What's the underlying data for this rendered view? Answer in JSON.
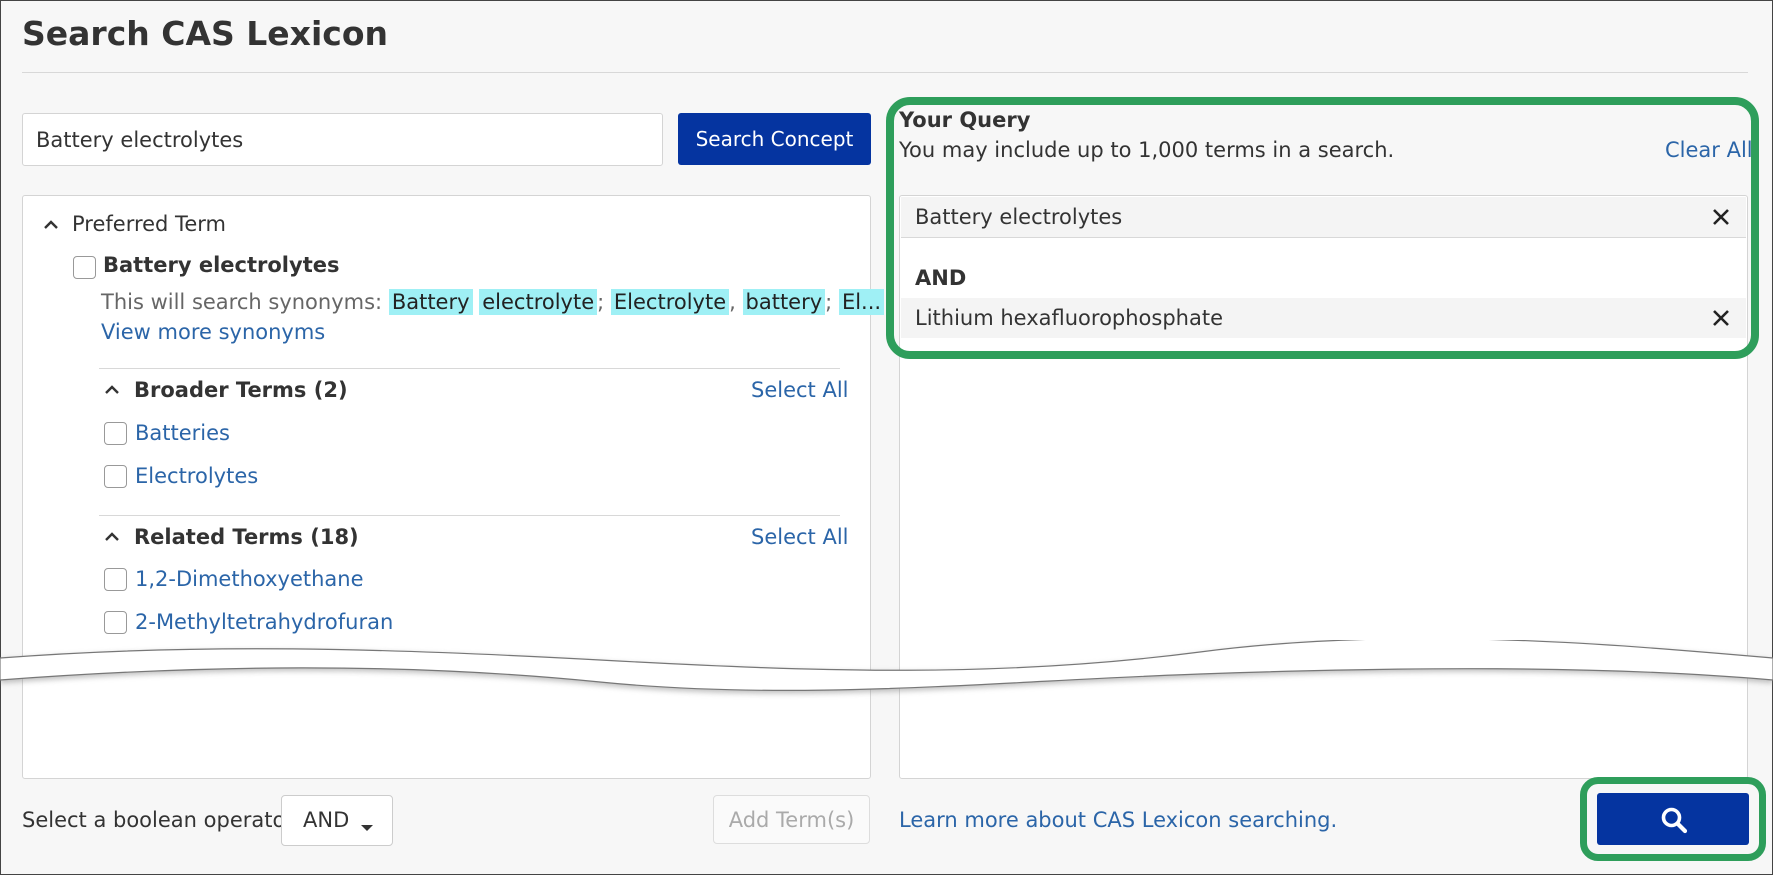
{
  "page": {
    "title": "Search CAS Lexicon"
  },
  "search": {
    "value": "Battery electrolytes",
    "button_label": "Search Concept"
  },
  "preferred": {
    "header": "Preferred Term",
    "term": "Battery electrolytes",
    "synonyms_prefix": "This will search synonyms:",
    "synonyms": [
      "Battery",
      "electrolyte",
      "Electrolyte",
      "battery",
      "El..."
    ],
    "separators": [
      ";",
      ",",
      ";"
    ],
    "view_more": "View more synonyms"
  },
  "broader": {
    "header": "Broader Terms (2)",
    "select_all": "Select All",
    "items": [
      "Batteries",
      "Electrolytes"
    ]
  },
  "related": {
    "header": "Related Terms (18)",
    "select_all": "Select All",
    "items": [
      "1,2-Dimethoxyethane",
      "2-Methyltetrahydrofuran"
    ]
  },
  "query": {
    "title": "Your Query",
    "hint": "You may include up to 1,000 terms in a search.",
    "clear_all": "Clear All",
    "items": [
      "Battery electrolytes",
      "Lithium hexafluorophosphate"
    ],
    "operator": "AND"
  },
  "bottom": {
    "operator_label": "Select a boolean operator",
    "operator_value": "AND",
    "add_terms": "Add Term(s)",
    "learn_more": "Learn more about CAS Lexicon searching."
  },
  "colors": {
    "primary": "#0534a0",
    "highlight_box": "#2e9e5b",
    "link": "#2b65a8",
    "synonym_highlight": "#9ff0f5"
  },
  "icons": [
    "chevron-up-icon",
    "close-icon",
    "caret-down-icon",
    "search-icon"
  ]
}
